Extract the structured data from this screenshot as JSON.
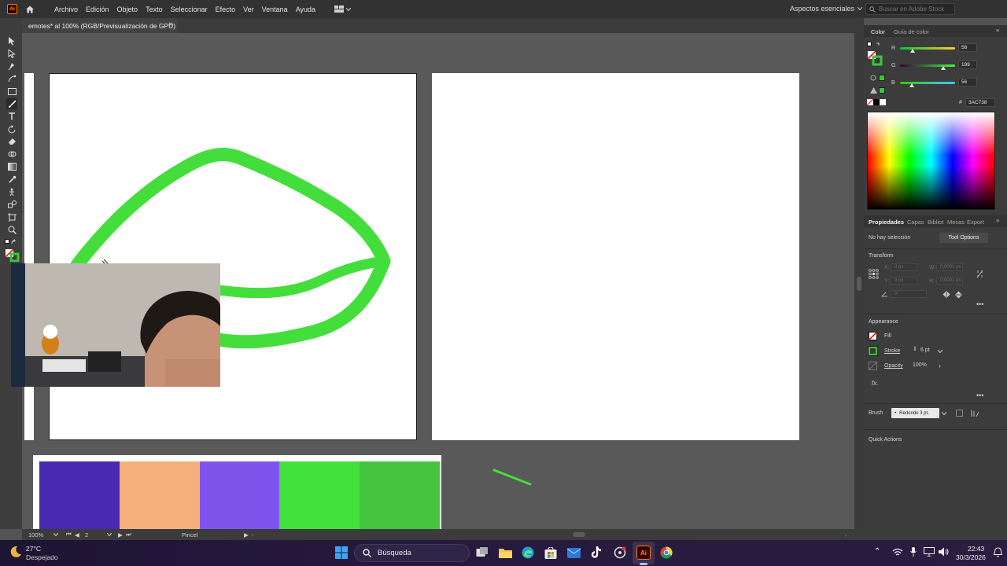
{
  "app": {
    "logo_text": "Ai",
    "menu": [
      "Archivo",
      "Edición",
      "Objeto",
      "Texto",
      "Seleccionar",
      "Efecto",
      "Ver",
      "Ventana",
      "Ayuda"
    ],
    "workspace": "Aspectos esenciales",
    "stock_search_placeholder": "Buscar en Adobe Stock"
  },
  "document_tab": {
    "title": "emotes* al 100% (RGB/Previsualización de GPU)",
    "close": "×"
  },
  "color_panel": {
    "tabs": [
      "Color",
      "Guía de color"
    ],
    "channels": [
      {
        "label": "R",
        "value": "58",
        "fraction": 0.227
      },
      {
        "label": "G",
        "value": "199",
        "fraction": 0.78
      },
      {
        "label": "B",
        "value": "56",
        "fraction": 0.22
      }
    ],
    "hex_label": "#",
    "hex": "3AC738",
    "current_color": "#3ac738"
  },
  "properties_panel": {
    "tabs": [
      "Propiedades",
      "Capas",
      "Bibliot",
      "Mesas",
      "Export"
    ],
    "selection": "No hay selección",
    "tool_options": "Tool Options",
    "transform_title": "Transform",
    "x_label": "X:",
    "x_value": "0 px",
    "y_label": "Y:",
    "y_value": "0 px",
    "w_label": "W:",
    "w_value": "0,0001 px",
    "h_label": "H:",
    "h_value": "0,0001 px",
    "angle_value": "0°",
    "appearance_title": "Appearance",
    "fill_label": "Fill",
    "stroke_label": "Stroke",
    "stroke_value": "6 pt",
    "opacity_label": "Opacity",
    "opacity_value": "100%",
    "fx_label": "fx.",
    "brush_label": "Brush",
    "brush_value": "Redondo 3 pt.",
    "quick_actions": "Quick Actions"
  },
  "status_bar": {
    "zoom": "100%",
    "artboard_number": "2",
    "tool_name": "Pincel"
  },
  "swatches": [
    "#4a29b3",
    "#f5b07c",
    "#7d55ec",
    "#42e23d",
    "#45c43d"
  ],
  "taskbar": {
    "weather_temp": "27°C",
    "weather_desc": "Despejado",
    "search_label": "Búsqueda",
    "time": "22:43",
    "date": "30/3/2026"
  }
}
